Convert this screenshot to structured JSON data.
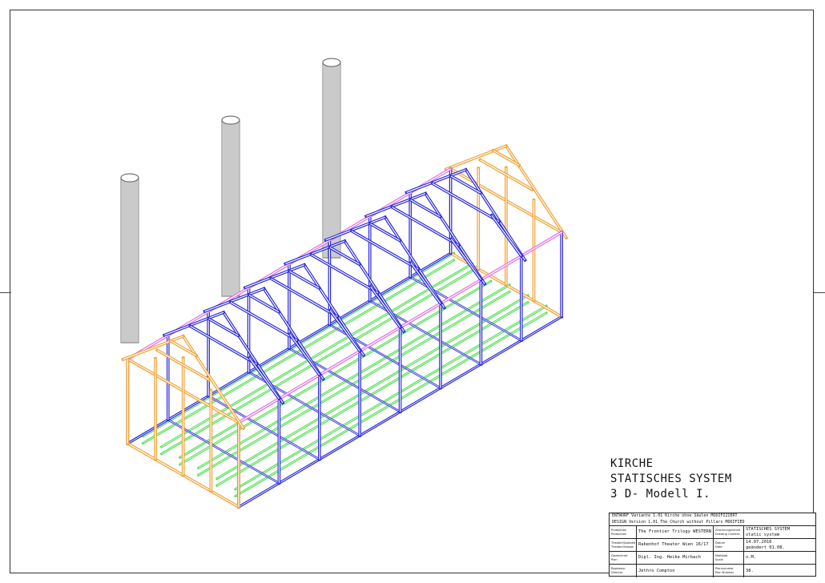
{
  "drawing": {
    "title_lines": [
      "KIRCHE",
      "STATISCHES SYSTEM",
      "3 D- Modell I."
    ],
    "colors": {
      "gable_frames": "#f0a030",
      "roof_trusses": "#2a2ad8",
      "eave_beams": "#e070e0",
      "floor_beams": "#40dd40",
      "pillars": "#7a7a7a"
    }
  },
  "title_block": {
    "design_line_de": "ENTWURF Variante 1.01   Kirche ohne Säulen MODIFIZIERT",
    "design_line_en": "DESIGN Version 1.01  The Church without Pillars MODIFIED",
    "rows": [
      {
        "label1_de": "Produktion",
        "label1_en": "Production",
        "value1": "The Frontier Trilogy WESTERN",
        "label2_de": "Zeichnungsinhalt",
        "label2_en": "Drawing Content",
        "value2_lines": [
          "STATISCHES SYSTEM",
          "static system"
        ]
      },
      {
        "label1_de": "Theater/Spielzeit",
        "label1_en": "Theater/Season",
        "value1": "Rabenhof Theater Wien 16/17",
        "label2_de": "Datum",
        "label2_en": "Date",
        "value2_lines": [
          "14.07.2016",
          "geändert 01.08."
        ]
      },
      {
        "label1_de": "Gezeichnet",
        "label1_en": "Plan",
        "value1": "Dipl. Ing. Heike Mirbach",
        "label2_de": "Maßstab",
        "label2_en": "Scale",
        "value2_lines": [
          "o.M."
        ]
      },
      {
        "label1_de": "Regisseur",
        "label1_en": "Director",
        "value1": "Jethro Compton",
        "label2_de": "Plannummer",
        "label2_en": "Plan Number",
        "value2_lines": [
          "38."
        ]
      }
    ]
  }
}
